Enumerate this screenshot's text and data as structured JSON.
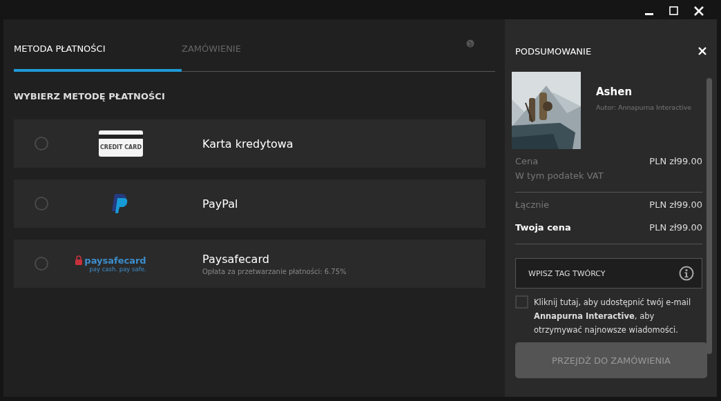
{
  "tabs": [
    {
      "label": "METODA PŁATNOŚCI",
      "selected": true
    },
    {
      "label": "ZAMÓWIENIE",
      "selected": false
    }
  ],
  "section_title": "WYBIERZ METODĘ PŁATNOŚCI",
  "payment_methods": [
    {
      "kind": "card",
      "logo_text": "CREDIT CARD",
      "name": "Karta kredytowa",
      "selected": false
    },
    {
      "kind": "paypal",
      "name": "PayPal",
      "selected": false
    },
    {
      "kind": "paysafe",
      "logo_text": "paysafecard",
      "logo_tagline": "pay cash. pay safe.",
      "name": "Paysafecard",
      "note": "Opłata za przetwarzanie płatności: 6.75%",
      "selected": false
    }
  ],
  "summary": {
    "title": "PODSUMOWANIE",
    "product": {
      "title": "Ashen",
      "author": "Autor: Annapurna Interactive"
    },
    "price_label": "Cena",
    "price": "PLN zł99.00",
    "vat_note": "W tym podatek VAT",
    "total_label": "Łącznie",
    "total": "PLN zł99.00",
    "your_price_label": "Twoja cena",
    "your_price": "PLN zł99.00",
    "creator_tag": {
      "placeholder": "WPISZ TAG TWÓRCY"
    },
    "consent": {
      "text": "Kliknij tutaj, aby udostępnić twój e-mail **Annapurna Interactive**, aby otrzymywać najnowsze wiadomości.",
      "checked": false
    },
    "button": {
      "label": "PRZEJDŹ DO ZAMÓWIENIA",
      "disabled": true
    }
  }
}
